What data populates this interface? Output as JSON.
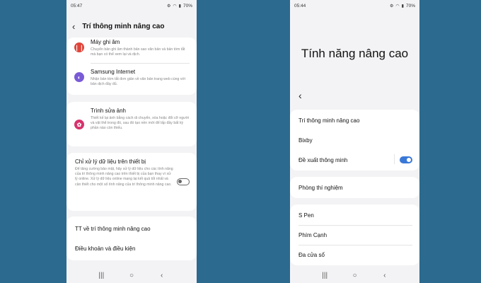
{
  "left": {
    "status": {
      "time": "05:47",
      "battery": "70%"
    },
    "header": {
      "title": "Trí thông minh nâng cao"
    },
    "apps": [
      {
        "title": "Máy ghi âm",
        "desc": "Chuyển bản ghi âm thành bản sao văn bản và bản tóm tắt mà bạn có thể xem lại và dịch.",
        "icon": "voice-recorder-icon",
        "color": "#e0453a"
      },
      {
        "title": "Samsung Internet",
        "desc": "Nhận bản tóm tắt đơn giản về văn bản trang web cùng với bản dịch đầy đủ.",
        "icon": "samsung-internet-icon",
        "color": "#7a5bd6"
      },
      {
        "title": "Trình sửa ảnh",
        "desc": "Thiết kế lại ảnh bằng cách di chuyển, xóa hoặc đổi cỡ người và vật thể trong đó, sau đó tạo nền mới để lấp đầy bất kỳ phần nào còn thiếu.",
        "icon": "photo-editor-icon",
        "color": "#d6336c"
      }
    ],
    "device_processing": {
      "title": "Chỉ xử lý dữ liệu trên thiết bị",
      "desc": "Để tăng cường bảo mật, hãy xử lý dữ liệu cho các tính năng của trí thông minh nâng cao trên thiết bị của bạn thay vì xử lý online. Xử lý dữ liệu online mang lại kết quả tốt nhất và cần thiết cho một số tính năng của trí thông minh nâng cao.",
      "enabled": false
    },
    "links": [
      "TT về trí thông minh nâng cao",
      "Điều khoản và điều kiện"
    ]
  },
  "right": {
    "status": {
      "time": "05:44",
      "battery": "70%"
    },
    "title": "Tính năng nâng cao",
    "group1": [
      "Trí thông minh nâng cao",
      "Bixby",
      "Đề xuất thông minh"
    ],
    "smart_suggestions_enabled": true,
    "group2": [
      "Phòng thí nghiệm"
    ],
    "group3": [
      "S Pen",
      "Phím Cạnh",
      "Đa cửa sổ"
    ]
  },
  "nav": {
    "recents": "|||",
    "home": "○",
    "back": "‹"
  }
}
